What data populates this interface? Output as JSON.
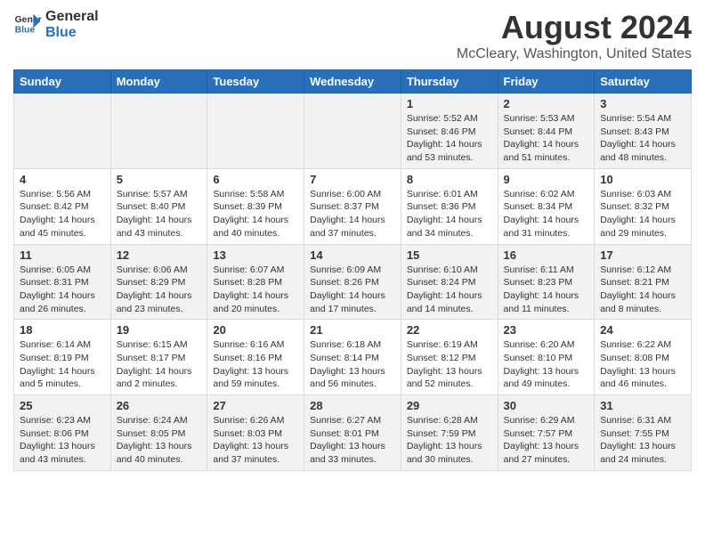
{
  "logo": {
    "line1": "General",
    "line2": "Blue"
  },
  "title": "August 2024",
  "subtitle": "McCleary, Washington, United States",
  "days_of_week": [
    "Sunday",
    "Monday",
    "Tuesday",
    "Wednesday",
    "Thursday",
    "Friday",
    "Saturday"
  ],
  "weeks": [
    [
      {
        "day": "",
        "info": ""
      },
      {
        "day": "",
        "info": ""
      },
      {
        "day": "",
        "info": ""
      },
      {
        "day": "",
        "info": ""
      },
      {
        "day": "1",
        "info": "Sunrise: 5:52 AM\nSunset: 8:46 PM\nDaylight: 14 hours\nand 53 minutes."
      },
      {
        "day": "2",
        "info": "Sunrise: 5:53 AM\nSunset: 8:44 PM\nDaylight: 14 hours\nand 51 minutes."
      },
      {
        "day": "3",
        "info": "Sunrise: 5:54 AM\nSunset: 8:43 PM\nDaylight: 14 hours\nand 48 minutes."
      }
    ],
    [
      {
        "day": "4",
        "info": "Sunrise: 5:56 AM\nSunset: 8:42 PM\nDaylight: 14 hours\nand 45 minutes."
      },
      {
        "day": "5",
        "info": "Sunrise: 5:57 AM\nSunset: 8:40 PM\nDaylight: 14 hours\nand 43 minutes."
      },
      {
        "day": "6",
        "info": "Sunrise: 5:58 AM\nSunset: 8:39 PM\nDaylight: 14 hours\nand 40 minutes."
      },
      {
        "day": "7",
        "info": "Sunrise: 6:00 AM\nSunset: 8:37 PM\nDaylight: 14 hours\nand 37 minutes."
      },
      {
        "day": "8",
        "info": "Sunrise: 6:01 AM\nSunset: 8:36 PM\nDaylight: 14 hours\nand 34 minutes."
      },
      {
        "day": "9",
        "info": "Sunrise: 6:02 AM\nSunset: 8:34 PM\nDaylight: 14 hours\nand 31 minutes."
      },
      {
        "day": "10",
        "info": "Sunrise: 6:03 AM\nSunset: 8:32 PM\nDaylight: 14 hours\nand 29 minutes."
      }
    ],
    [
      {
        "day": "11",
        "info": "Sunrise: 6:05 AM\nSunset: 8:31 PM\nDaylight: 14 hours\nand 26 minutes."
      },
      {
        "day": "12",
        "info": "Sunrise: 6:06 AM\nSunset: 8:29 PM\nDaylight: 14 hours\nand 23 minutes."
      },
      {
        "day": "13",
        "info": "Sunrise: 6:07 AM\nSunset: 8:28 PM\nDaylight: 14 hours\nand 20 minutes."
      },
      {
        "day": "14",
        "info": "Sunrise: 6:09 AM\nSunset: 8:26 PM\nDaylight: 14 hours\nand 17 minutes."
      },
      {
        "day": "15",
        "info": "Sunrise: 6:10 AM\nSunset: 8:24 PM\nDaylight: 14 hours\nand 14 minutes."
      },
      {
        "day": "16",
        "info": "Sunrise: 6:11 AM\nSunset: 8:23 PM\nDaylight: 14 hours\nand 11 minutes."
      },
      {
        "day": "17",
        "info": "Sunrise: 6:12 AM\nSunset: 8:21 PM\nDaylight: 14 hours\nand 8 minutes."
      }
    ],
    [
      {
        "day": "18",
        "info": "Sunrise: 6:14 AM\nSunset: 8:19 PM\nDaylight: 14 hours\nand 5 minutes."
      },
      {
        "day": "19",
        "info": "Sunrise: 6:15 AM\nSunset: 8:17 PM\nDaylight: 14 hours\nand 2 minutes."
      },
      {
        "day": "20",
        "info": "Sunrise: 6:16 AM\nSunset: 8:16 PM\nDaylight: 13 hours\nand 59 minutes."
      },
      {
        "day": "21",
        "info": "Sunrise: 6:18 AM\nSunset: 8:14 PM\nDaylight: 13 hours\nand 56 minutes."
      },
      {
        "day": "22",
        "info": "Sunrise: 6:19 AM\nSunset: 8:12 PM\nDaylight: 13 hours\nand 52 minutes."
      },
      {
        "day": "23",
        "info": "Sunrise: 6:20 AM\nSunset: 8:10 PM\nDaylight: 13 hours\nand 49 minutes."
      },
      {
        "day": "24",
        "info": "Sunrise: 6:22 AM\nSunset: 8:08 PM\nDaylight: 13 hours\nand 46 minutes."
      }
    ],
    [
      {
        "day": "25",
        "info": "Sunrise: 6:23 AM\nSunset: 8:06 PM\nDaylight: 13 hours\nand 43 minutes."
      },
      {
        "day": "26",
        "info": "Sunrise: 6:24 AM\nSunset: 8:05 PM\nDaylight: 13 hours\nand 40 minutes."
      },
      {
        "day": "27",
        "info": "Sunrise: 6:26 AM\nSunset: 8:03 PM\nDaylight: 13 hours\nand 37 minutes."
      },
      {
        "day": "28",
        "info": "Sunrise: 6:27 AM\nSunset: 8:01 PM\nDaylight: 13 hours\nand 33 minutes."
      },
      {
        "day": "29",
        "info": "Sunrise: 6:28 AM\nSunset: 7:59 PM\nDaylight: 13 hours\nand 30 minutes."
      },
      {
        "day": "30",
        "info": "Sunrise: 6:29 AM\nSunset: 7:57 PM\nDaylight: 13 hours\nand 27 minutes."
      },
      {
        "day": "31",
        "info": "Sunrise: 6:31 AM\nSunset: 7:55 PM\nDaylight: 13 hours\nand 24 minutes."
      }
    ]
  ]
}
